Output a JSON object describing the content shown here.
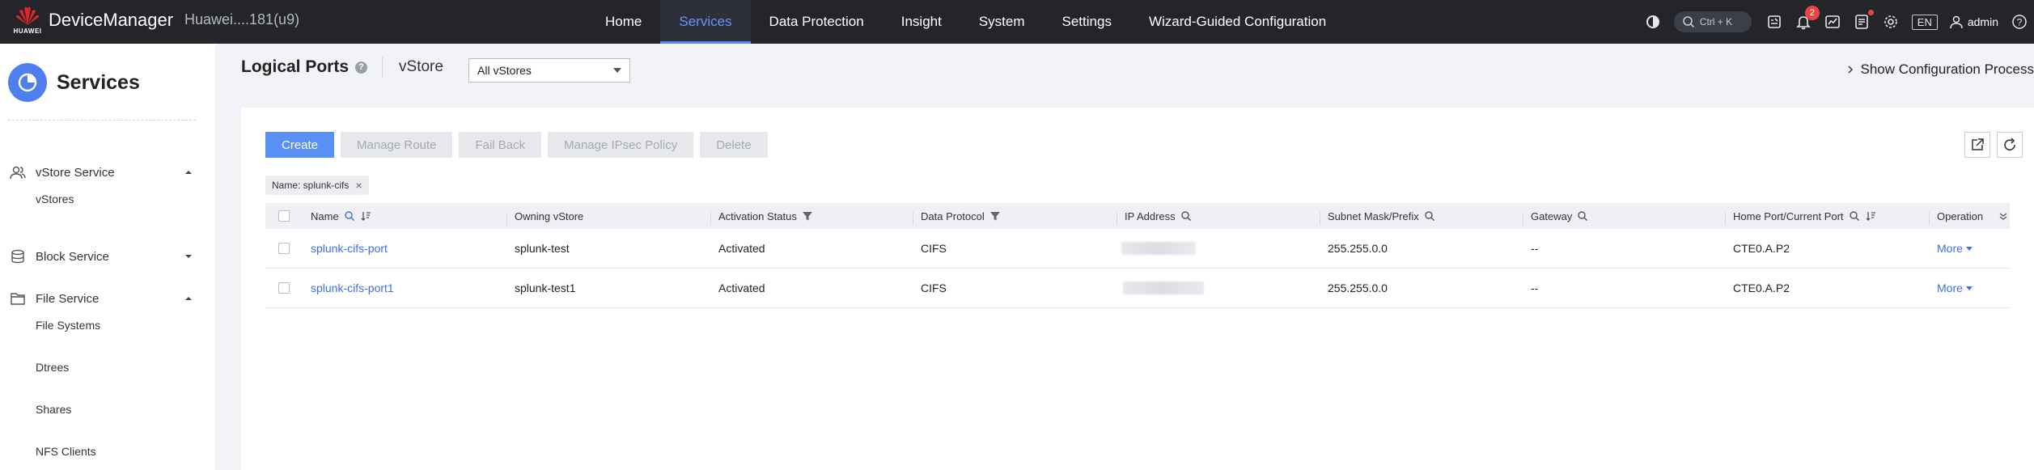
{
  "topbar": {
    "logo_text": "HUAWEI",
    "app_title": "DeviceManager",
    "device_name": "Huawei....181(u9)",
    "nav": [
      {
        "label": "Home",
        "active": false
      },
      {
        "label": "Services",
        "active": true
      },
      {
        "label": "Data Protection",
        "active": false
      },
      {
        "label": "Insight",
        "active": false
      },
      {
        "label": "System",
        "active": false
      },
      {
        "label": "Settings",
        "active": false
      },
      {
        "label": "Wizard-Guided Configuration",
        "active": false
      }
    ],
    "search_shortcut": "Ctrl + K",
    "alarm_count": "2",
    "language": "EN",
    "user": "admin"
  },
  "sidebar": {
    "title": "Services",
    "groups": [
      {
        "label": "vStore Service",
        "icon": "users-icon",
        "expanded": true,
        "items": [
          "vStores"
        ]
      },
      {
        "label": "Block Service",
        "icon": "database-icon",
        "expanded": false,
        "items": []
      },
      {
        "label": "File Service",
        "icon": "folder-icon",
        "expanded": true,
        "items": [
          "File Systems",
          "Dtrees",
          "Shares",
          "NFS Clients"
        ]
      }
    ]
  },
  "header": {
    "title": "Logical Ports",
    "vstore_label": "vStore",
    "vstore_selected": "All vStores",
    "show_config": "Show Configuration Process"
  },
  "toolbar": {
    "create": "Create",
    "manage_route": "Manage Route",
    "fail_back": "Fail Back",
    "manage_ipsec": "Manage IPsec Policy",
    "delete": "Delete"
  },
  "filter_tag": "Name: splunk-cifs",
  "table": {
    "columns": [
      "Name",
      "Owning vStore",
      "Activation Status",
      "Data Protocol",
      "IP Address",
      "Subnet Mask/Prefix",
      "Gateway",
      "Home Port/Current Port",
      "Operation"
    ],
    "rows": [
      {
        "name": "splunk-cifs-port",
        "vstore": "splunk-test",
        "status": "Activated",
        "protocol": "CIFS",
        "subnet": "255.255.0.0",
        "gateway": "--",
        "port": "CTE0.A.P2",
        "operation": "More"
      },
      {
        "name": "splunk-cifs-port1",
        "vstore": "splunk-test1",
        "status": "Activated",
        "protocol": "CIFS",
        "subnet": "255.255.0.0",
        "gateway": "--",
        "port": "CTE0.A.P2",
        "operation": "More"
      }
    ]
  },
  "colors": {
    "accent": "#5a8ff5",
    "topbar_bg": "#23252b",
    "link": "#3c6fe8",
    "badge": "#e94545"
  }
}
